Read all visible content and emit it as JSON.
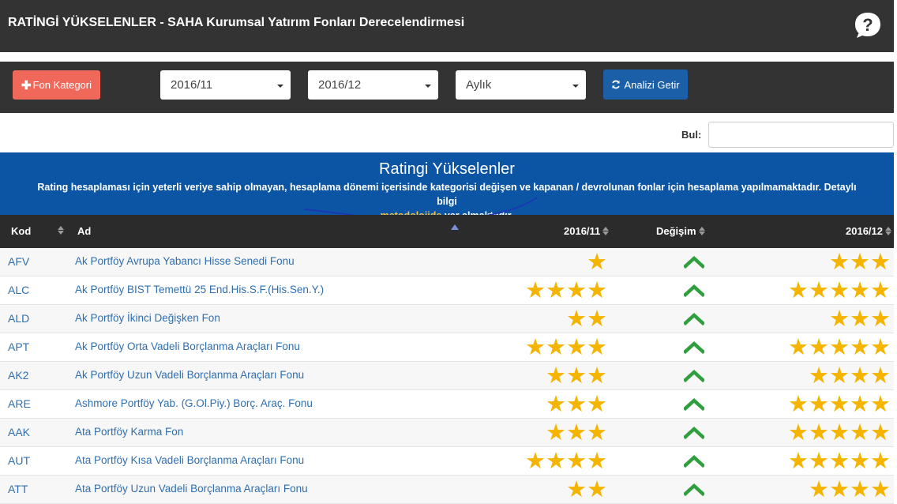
{
  "header": {
    "title": "RATİNGİ YÜKSELENLER - SAHA Kurumsal Yatırım Fonları Derecelendirmesi",
    "help_icon": "question-bubble-icon"
  },
  "toolbar": {
    "fon_button_label": "Fon Kategori",
    "period_start": "2016/11",
    "period_end": "2016/12",
    "frequency": "Aylık",
    "analyze_button_label": "Analizi Getir"
  },
  "search": {
    "label": "Bul:",
    "value": ""
  },
  "banner": {
    "title": "Ratingi Yükselenler",
    "text_before_link": "Rating hesaplaması için yeterli veriye sahip olmayan, hesaplama dönemi içerisinde kategorisi değişen ve kapanan / devrolunan fonlar için hesaplama yapılmamaktadır. Detaylı bilgi",
    "link_text": "metodolojide",
    "text_after_link": "yer almaktadır."
  },
  "table": {
    "columns": {
      "kod": "Kod",
      "ad": "Ad",
      "start": "2016/11",
      "change": "Değişim",
      "end": "2016/12"
    },
    "rows": [
      {
        "kod": "AFV",
        "ad": "Ak Portföy Avrupa Yabancı Hisse Senedi Fonu",
        "start": 1,
        "end": 3
      },
      {
        "kod": "ALC",
        "ad": "Ak Portföy BIST Temettü 25 End.His.S.F.(His.Sen.Y.)",
        "start": 4,
        "end": 5
      },
      {
        "kod": "ALD",
        "ad": "Ak Portföy İkinci Değişken Fon",
        "start": 2,
        "end": 3
      },
      {
        "kod": "APT",
        "ad": "Ak Portföy Orta Vadeli Borçlanma Araçları Fonu",
        "start": 4,
        "end": 5
      },
      {
        "kod": "AK2",
        "ad": "Ak Portföy Uzun Vadeli Borçlanma Araçları Fonu",
        "start": 3,
        "end": 4
      },
      {
        "kod": "ARE",
        "ad": "Ashmore Portföy Yab. (G.Ol.Piy.) Borç. Araç. Fonu",
        "start": 3,
        "end": 5
      },
      {
        "kod": "AAK",
        "ad": "Ata Portföy Karma Fon",
        "start": 3,
        "end": 5
      },
      {
        "kod": "AUT",
        "ad": "Ata Portföy Kısa Vadeli Borçlanma Araçları Fonu",
        "start": 4,
        "end": 5
      },
      {
        "kod": "ATT",
        "ad": "Ata Portföy Uzun Vadeli Borçlanma Araçları Fonu",
        "start": 2,
        "end": 4
      }
    ]
  },
  "colors": {
    "star": "#f4b400",
    "up_arrow": "#2e9e3e",
    "banner": "#0c55a4",
    "link": "#2f6fb0"
  }
}
